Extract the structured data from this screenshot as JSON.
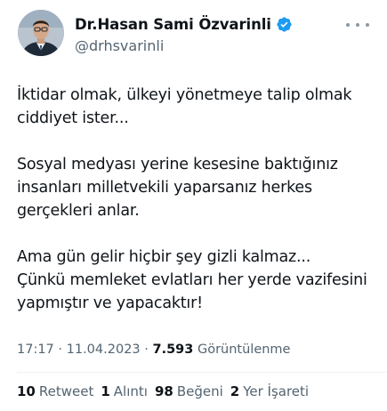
{
  "author": {
    "display_name": "Dr.Hasan Sami Özvarinli",
    "handle": "@drhsvarinli",
    "verified": true,
    "verified_color": "#1d9bf0"
  },
  "tweet": {
    "paragraphs": [
      "İktidar olmak, ülkeyi yönetmeye talip olmak\nciddiyet ister...",
      "Sosyal medyası yerine kesesine baktığınız\ninsanları milletvekili yaparsanız herkes\ngerçekleri anlar.",
      "Ama gün gelir hiçbir şey gizli kalmaz...\nÇünkü memleket evlatları her yerde vazifesini\nyapmıştır ve yapacaktır!"
    ]
  },
  "meta": {
    "time": "17:17",
    "date": "11.04.2023",
    "views_count": "7.593",
    "views_label": "Görüntülenme"
  },
  "stats": {
    "retweets_count": "10",
    "retweets_label": "Retweet",
    "quotes_count": "1",
    "quotes_label": "Alıntı",
    "likes_count": "98",
    "likes_label": "Beğeni",
    "bookmarks_count": "2",
    "bookmarks_label": "Yer İşareti"
  },
  "icons": {
    "more": "more-options-icon",
    "verified": "verified-badge-icon"
  }
}
